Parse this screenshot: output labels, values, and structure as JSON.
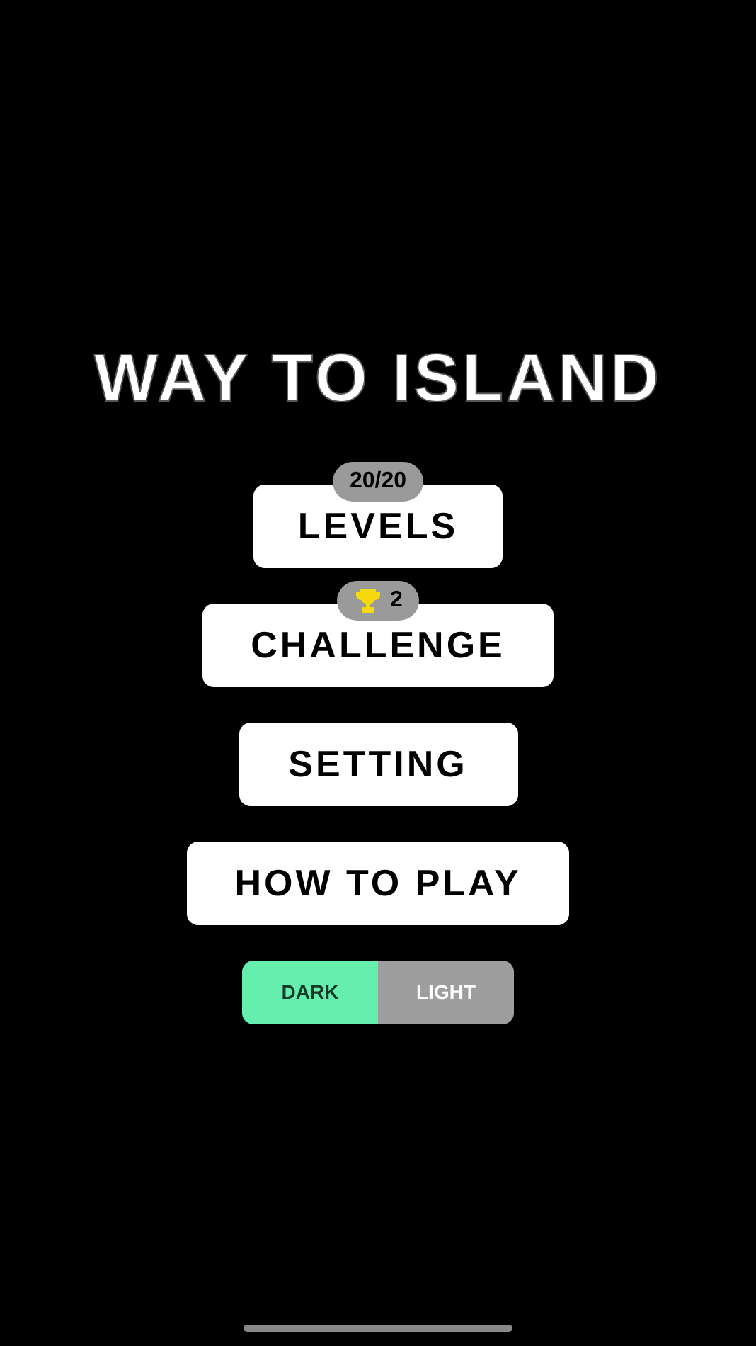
{
  "title": "WAY TO ISLAND",
  "menu": [
    {
      "label": "LEVELS",
      "badge": {
        "kind": "count",
        "text": "20/20"
      }
    },
    {
      "label": "CHALLENGE",
      "badge": {
        "kind": "trophy",
        "text": "2"
      }
    },
    {
      "label": "SETTING"
    },
    {
      "label": "HOW TO PLAY"
    }
  ],
  "theme_toggle": [
    {
      "label": "DARK",
      "selected": true
    },
    {
      "label": "LIGHT",
      "selected": false
    }
  ]
}
